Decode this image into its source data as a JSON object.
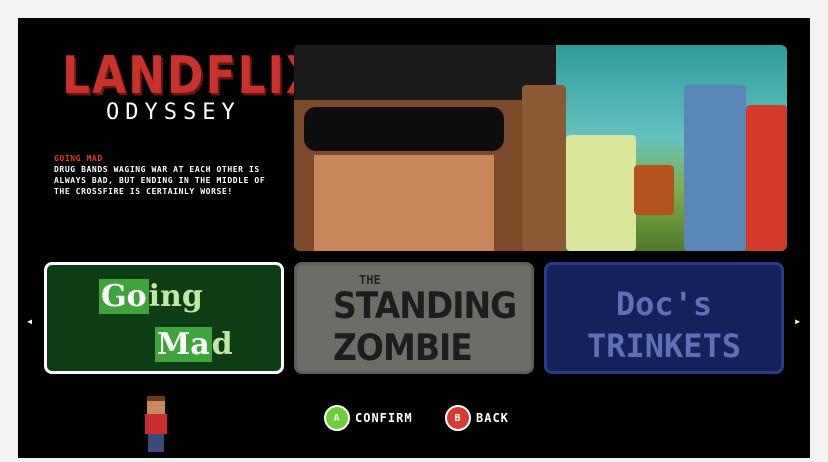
{
  "game": {
    "logo_main": "LANDFLIX",
    "logo_sub": "ODYSSEY"
  },
  "episode": {
    "title": "GOING MAD",
    "description": "DRUG BANDS WAGING WAR AT EACH OTHER IS ALWAYS BAD, BUT ENDING IN THE MIDDLE OF THE CROSSFIRE IS CERTAINLY WORSE!"
  },
  "tiles": [
    {
      "word1_a": "Go",
      "word1_b": "ing",
      "word2_a": "Ma",
      "word2_b": "d",
      "selected": true
    },
    {
      "the": "THE",
      "line1": "STANDING",
      "line2": "ZOMBIE"
    },
    {
      "line1": "Doc's",
      "line2": "TRINKETS"
    }
  ],
  "nav": {
    "left_arrow": "◂",
    "right_arrow": "▸"
  },
  "buttons": {
    "confirm": {
      "glyph": "A",
      "label": "CONFIRM"
    },
    "back": {
      "glyph": "B",
      "label": "BACK"
    }
  },
  "colors": {
    "accent_red": "#c8312c",
    "confirm_green": "#6bcf3a",
    "back_red": "#d83a34"
  }
}
